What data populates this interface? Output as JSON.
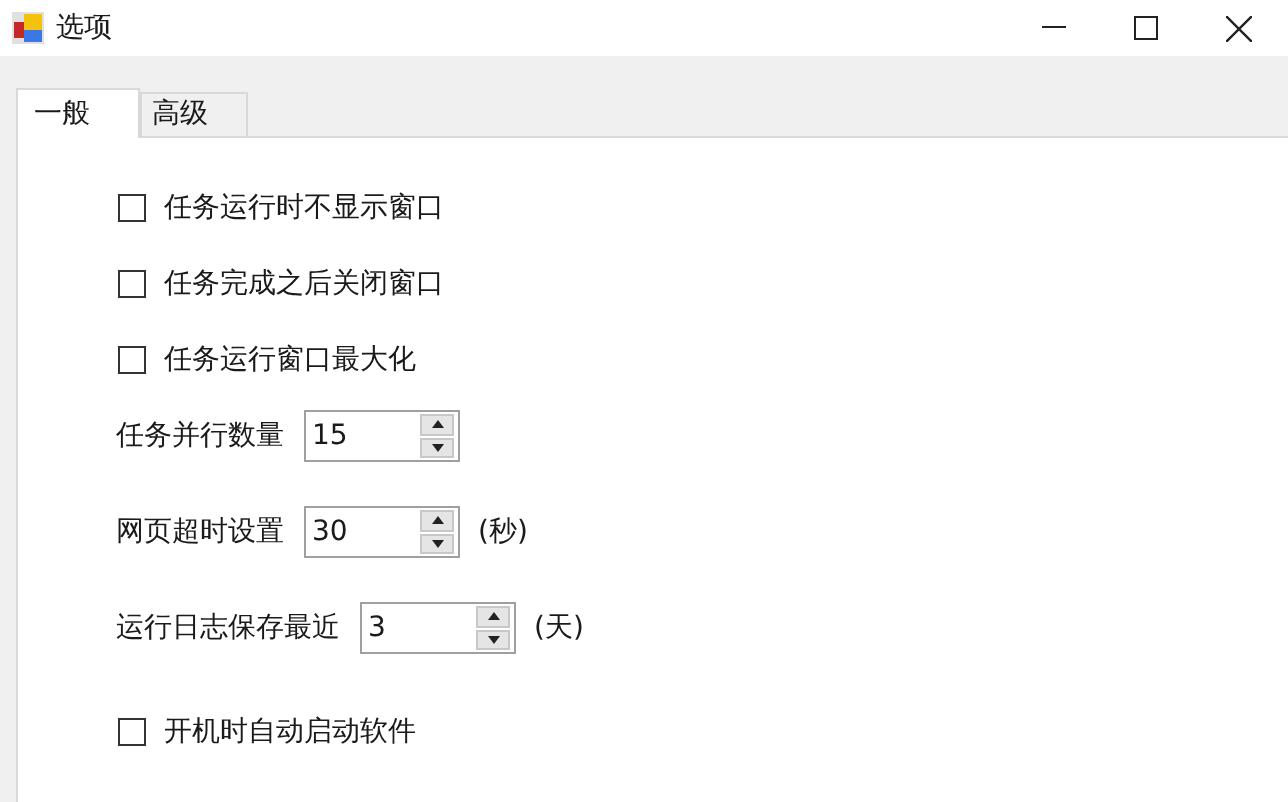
{
  "window": {
    "title": "选项"
  },
  "tabs": [
    {
      "label": "一般",
      "selected": true
    },
    {
      "label": "高级",
      "selected": false
    }
  ],
  "options": [
    {
      "kind": "checkbox",
      "label": "任务运行时不显示窗口",
      "checked": false
    },
    {
      "kind": "checkbox",
      "label": "任务完成之后关闭窗口",
      "checked": false
    },
    {
      "kind": "checkbox",
      "label": "任务运行窗口最大化",
      "checked": false
    },
    {
      "kind": "spinner",
      "label": "任务并行数量",
      "value": "15"
    },
    {
      "kind": "spinner",
      "label": "网页超时设置",
      "value": "30",
      "unit": "(秒)"
    },
    {
      "kind": "spinner",
      "label": "运行日志保存最近",
      "value": "3",
      "unit": "(天)"
    },
    {
      "kind": "checkbox",
      "label": "开机时自动启动软件",
      "checked": false
    }
  ]
}
